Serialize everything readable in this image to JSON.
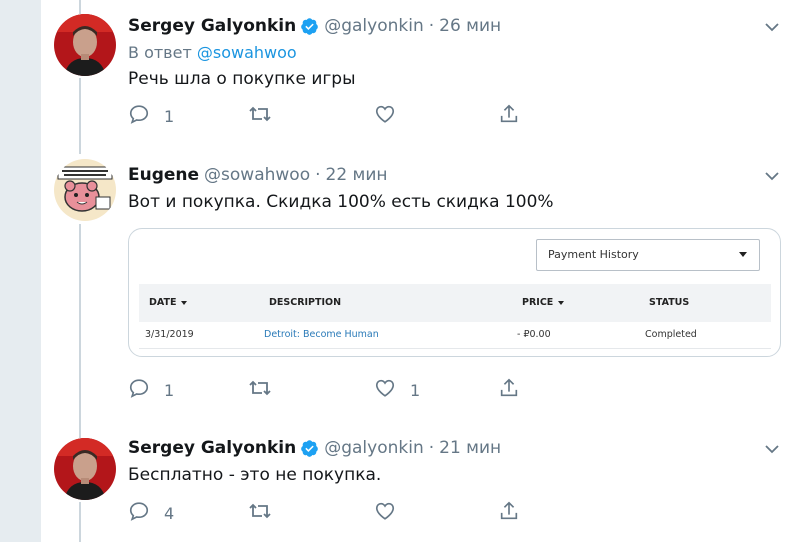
{
  "tweets": [
    {
      "name": "Sergey Galyonkin",
      "verified": true,
      "handle": "@galyonkin",
      "dot": "·",
      "time": "26 мин",
      "reply_prefix": "В ответ",
      "reply_to": "@sowahwoo",
      "text": "Речь шла о покупке игры",
      "reply_count": "1",
      "retweet_count": "",
      "like_count": ""
    },
    {
      "name": "Eugene",
      "verified": false,
      "handle": "@sowahwoo",
      "dot": "·",
      "time": "22 мин",
      "text": "Вот и покупка. Скидка 100% есть скидка 100%",
      "reply_count": "1",
      "retweet_count": "",
      "like_count": "1",
      "card": {
        "select_value": "Payment History",
        "columns": [
          "DATE",
          "DESCRIPTION",
          "PRICE",
          "STATUS"
        ],
        "row": {
          "date": "3/31/2019",
          "description": "Detroit: Become Human",
          "price": "- ₽0.00",
          "status": "Completed"
        }
      }
    },
    {
      "name": "Sergey Galyonkin",
      "verified": true,
      "handle": "@galyonkin",
      "dot": "·",
      "time": "21 мин",
      "text": "Бесплатно - это не покупка.",
      "reply_count": "4",
      "retweet_count": "",
      "like_count": ""
    }
  ],
  "colors": {
    "link": "#1b95e0",
    "secondary_text": "#657786",
    "verified": "#1da1f2",
    "thread_line": "#ccd6dd"
  }
}
